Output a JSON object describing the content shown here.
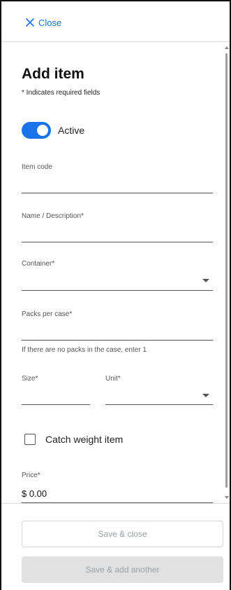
{
  "header": {
    "close_label": "Close"
  },
  "form": {
    "title": "Add item",
    "required_note": "* Indicates required fields",
    "active": {
      "label": "Active",
      "on": true
    },
    "item_code": {
      "label": "Item code",
      "value": ""
    },
    "name": {
      "label": "Name / Description",
      "required_mark": "*",
      "value": ""
    },
    "container": {
      "label": "Container",
      "required_mark": "*",
      "value": ""
    },
    "packs_per_case": {
      "label": "Packs per case",
      "required_mark": "*",
      "value": "",
      "helper": "If there are no packs in the case, enter 1"
    },
    "size": {
      "label": "Size",
      "required_mark": "*",
      "value": ""
    },
    "unit": {
      "label": "Unit",
      "required_mark": "*",
      "value": ""
    },
    "catch_weight": {
      "label": "Catch weight item",
      "checked": false
    },
    "price": {
      "label": "Price",
      "required_mark": "*",
      "value": "$ 0.00"
    }
  },
  "footer": {
    "save_close_label": "Save & close",
    "save_add_label": "Save & add another"
  },
  "colors": {
    "accent": "#1a73e8",
    "disabled_text": "#9aa0a6",
    "disabled_bg": "#e1e1e1"
  }
}
